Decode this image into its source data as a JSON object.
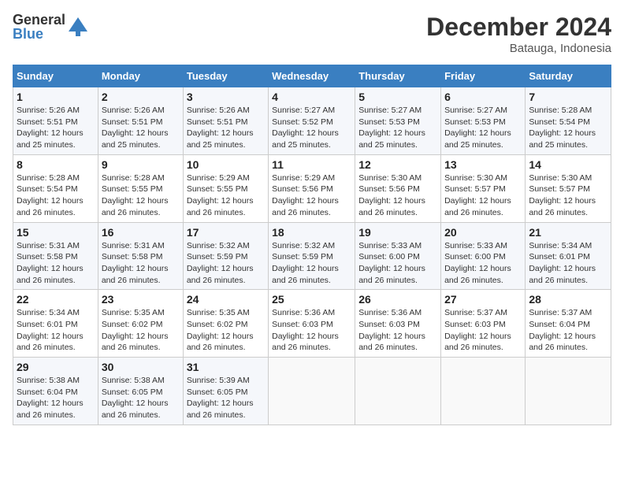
{
  "logo": {
    "general": "General",
    "blue": "Blue"
  },
  "header": {
    "month": "December 2024",
    "location": "Batauga, Indonesia"
  },
  "weekdays": [
    "Sunday",
    "Monday",
    "Tuesday",
    "Wednesday",
    "Thursday",
    "Friday",
    "Saturday"
  ],
  "weeks": [
    [
      {
        "day": 1,
        "sunrise": "5:26 AM",
        "sunset": "5:51 PM",
        "daylight": "12 hours and 25 minutes."
      },
      {
        "day": 2,
        "sunrise": "5:26 AM",
        "sunset": "5:51 PM",
        "daylight": "12 hours and 25 minutes."
      },
      {
        "day": 3,
        "sunrise": "5:26 AM",
        "sunset": "5:51 PM",
        "daylight": "12 hours and 25 minutes."
      },
      {
        "day": 4,
        "sunrise": "5:27 AM",
        "sunset": "5:52 PM",
        "daylight": "12 hours and 25 minutes."
      },
      {
        "day": 5,
        "sunrise": "5:27 AM",
        "sunset": "5:53 PM",
        "daylight": "12 hours and 25 minutes."
      },
      {
        "day": 6,
        "sunrise": "5:27 AM",
        "sunset": "5:53 PM",
        "daylight": "12 hours and 25 minutes."
      },
      {
        "day": 7,
        "sunrise": "5:28 AM",
        "sunset": "5:54 PM",
        "daylight": "12 hours and 25 minutes."
      }
    ],
    [
      {
        "day": 8,
        "sunrise": "5:28 AM",
        "sunset": "5:54 PM",
        "daylight": "12 hours and 26 minutes."
      },
      {
        "day": 9,
        "sunrise": "5:28 AM",
        "sunset": "5:55 PM",
        "daylight": "12 hours and 26 minutes."
      },
      {
        "day": 10,
        "sunrise": "5:29 AM",
        "sunset": "5:55 PM",
        "daylight": "12 hours and 26 minutes."
      },
      {
        "day": 11,
        "sunrise": "5:29 AM",
        "sunset": "5:56 PM",
        "daylight": "12 hours and 26 minutes."
      },
      {
        "day": 12,
        "sunrise": "5:30 AM",
        "sunset": "5:56 PM",
        "daylight": "12 hours and 26 minutes."
      },
      {
        "day": 13,
        "sunrise": "5:30 AM",
        "sunset": "5:57 PM",
        "daylight": "12 hours and 26 minutes."
      },
      {
        "day": 14,
        "sunrise": "5:30 AM",
        "sunset": "5:57 PM",
        "daylight": "12 hours and 26 minutes."
      }
    ],
    [
      {
        "day": 15,
        "sunrise": "5:31 AM",
        "sunset": "5:58 PM",
        "daylight": "12 hours and 26 minutes."
      },
      {
        "day": 16,
        "sunrise": "5:31 AM",
        "sunset": "5:58 PM",
        "daylight": "12 hours and 26 minutes."
      },
      {
        "day": 17,
        "sunrise": "5:32 AM",
        "sunset": "5:59 PM",
        "daylight": "12 hours and 26 minutes."
      },
      {
        "day": 18,
        "sunrise": "5:32 AM",
        "sunset": "5:59 PM",
        "daylight": "12 hours and 26 minutes."
      },
      {
        "day": 19,
        "sunrise": "5:33 AM",
        "sunset": "6:00 PM",
        "daylight": "12 hours and 26 minutes."
      },
      {
        "day": 20,
        "sunrise": "5:33 AM",
        "sunset": "6:00 PM",
        "daylight": "12 hours and 26 minutes."
      },
      {
        "day": 21,
        "sunrise": "5:34 AM",
        "sunset": "6:01 PM",
        "daylight": "12 hours and 26 minutes."
      }
    ],
    [
      {
        "day": 22,
        "sunrise": "5:34 AM",
        "sunset": "6:01 PM",
        "daylight": "12 hours and 26 minutes."
      },
      {
        "day": 23,
        "sunrise": "5:35 AM",
        "sunset": "6:02 PM",
        "daylight": "12 hours and 26 minutes."
      },
      {
        "day": 24,
        "sunrise": "5:35 AM",
        "sunset": "6:02 PM",
        "daylight": "12 hours and 26 minutes."
      },
      {
        "day": 25,
        "sunrise": "5:36 AM",
        "sunset": "6:03 PM",
        "daylight": "12 hours and 26 minutes."
      },
      {
        "day": 26,
        "sunrise": "5:36 AM",
        "sunset": "6:03 PM",
        "daylight": "12 hours and 26 minutes."
      },
      {
        "day": 27,
        "sunrise": "5:37 AM",
        "sunset": "6:03 PM",
        "daylight": "12 hours and 26 minutes."
      },
      {
        "day": 28,
        "sunrise": "5:37 AM",
        "sunset": "6:04 PM",
        "daylight": "12 hours and 26 minutes."
      }
    ],
    [
      {
        "day": 29,
        "sunrise": "5:38 AM",
        "sunset": "6:04 PM",
        "daylight": "12 hours and 26 minutes."
      },
      {
        "day": 30,
        "sunrise": "5:38 AM",
        "sunset": "6:05 PM",
        "daylight": "12 hours and 26 minutes."
      },
      {
        "day": 31,
        "sunrise": "5:39 AM",
        "sunset": "6:05 PM",
        "daylight": "12 hours and 26 minutes."
      },
      null,
      null,
      null,
      null
    ]
  ]
}
